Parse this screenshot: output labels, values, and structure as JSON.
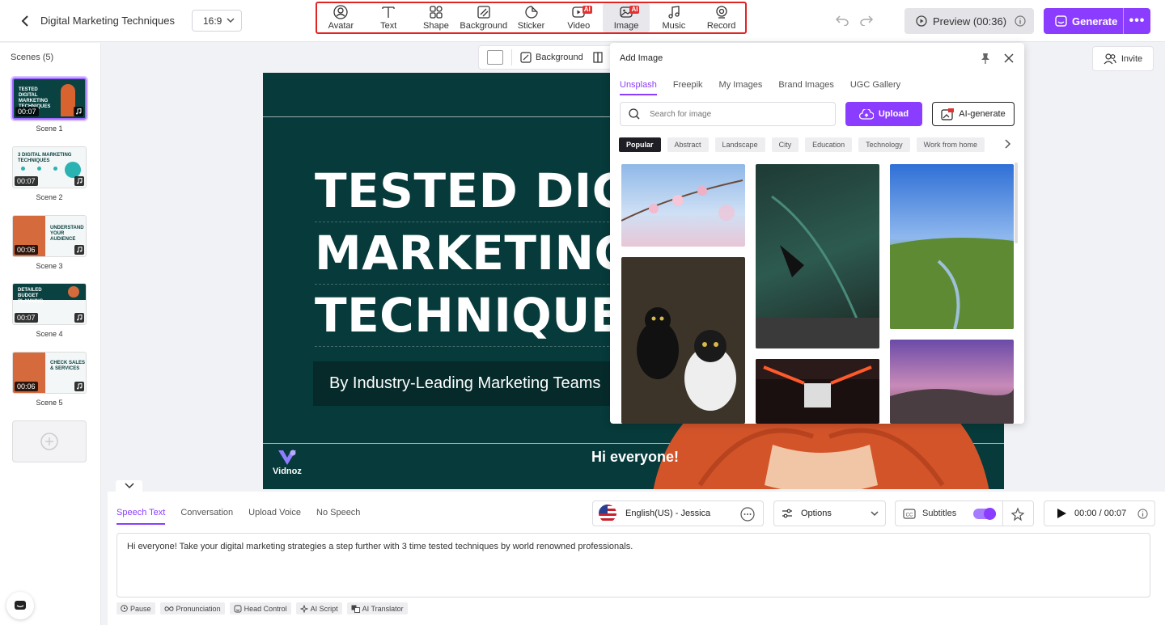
{
  "header": {
    "project_title": "Digital Marketing Techniques",
    "aspect_ratio": "16:9",
    "tools": [
      {
        "label": "Avatar",
        "icon": "avatar-icon",
        "ai": false,
        "active": false
      },
      {
        "label": "Text",
        "icon": "text-icon",
        "ai": false,
        "active": false
      },
      {
        "label": "Shape",
        "icon": "shape-icon",
        "ai": false,
        "active": false
      },
      {
        "label": "Background",
        "icon": "background-icon",
        "ai": false,
        "active": false
      },
      {
        "label": "Sticker",
        "icon": "sticker-icon",
        "ai": false,
        "active": false
      },
      {
        "label": "Video",
        "icon": "video-icon",
        "ai": true,
        "active": false
      },
      {
        "label": "Image",
        "icon": "image-icon",
        "ai": true,
        "active": true
      },
      {
        "label": "Music",
        "icon": "music-icon",
        "ai": false,
        "active": false
      },
      {
        "label": "Record",
        "icon": "record-icon",
        "ai": false,
        "active": false
      }
    ],
    "ai_badge": "AI",
    "preview_label": "Preview (00:36)",
    "generate_label": "Generate",
    "generate_more": "•••"
  },
  "scenes": {
    "title": "Scenes (5)",
    "items": [
      {
        "label": "Scene 1",
        "duration": "00:07",
        "thumb_text": "TESTED DIGITAL MARKETING TECHNIQUES"
      },
      {
        "label": "Scene 2",
        "duration": "00:07",
        "thumb_text": "3 DIGITAL MARKETING TECHNIQUES"
      },
      {
        "label": "Scene 3",
        "duration": "00:06",
        "thumb_text": "UNDERSTAND YOUR AUDIENCE"
      },
      {
        "label": "Scene 4",
        "duration": "00:07",
        "thumb_text": "DETAILED BUDGET PLANNING"
      },
      {
        "label": "Scene 5",
        "duration": "00:06",
        "thumb_text": "CHECK SALES & SERVICES"
      }
    ]
  },
  "canvas": {
    "toolbar_background_label": "Background",
    "invite_label": "Invite",
    "headline_lines": [
      "TESTED DIGITAL",
      "MARKETING",
      "TECHNIQUES"
    ],
    "subtitle_banner": "By Industry-Leading Marketing Teams",
    "caption": "Hi everyone!",
    "brand": "Vidnoz"
  },
  "add_image": {
    "title": "Add Image",
    "tabs": [
      "Unsplash",
      "Freepik",
      "My Images",
      "Brand Images",
      "UGC Gallery"
    ],
    "search_placeholder": "Search for image",
    "upload_label": "Upload",
    "ai_generate_label": "AI-generate",
    "chips": [
      "Popular",
      "Abstract",
      "Landscape",
      "City",
      "Education",
      "Technology",
      "Work from home"
    ]
  },
  "bottom": {
    "tabs": [
      "Speech Text",
      "Conversation",
      "Upload Voice",
      "No Speech"
    ],
    "voice": "English(US) - Jessica",
    "options_label": "Options",
    "subtitles_label": "Subtitles",
    "time": "00:00 / 00:07",
    "script": "Hi everyone! Take your digital marketing strategies a step further with 3 time tested techniques by world renowned professionals.",
    "script_tools": [
      "Pause",
      "Pronunciation",
      "Head Control",
      "AI Script",
      "AI Translator"
    ]
  },
  "colors": {
    "accent": "#8b3dff",
    "stage": "#073a3a",
    "highlight": "#e02424"
  }
}
